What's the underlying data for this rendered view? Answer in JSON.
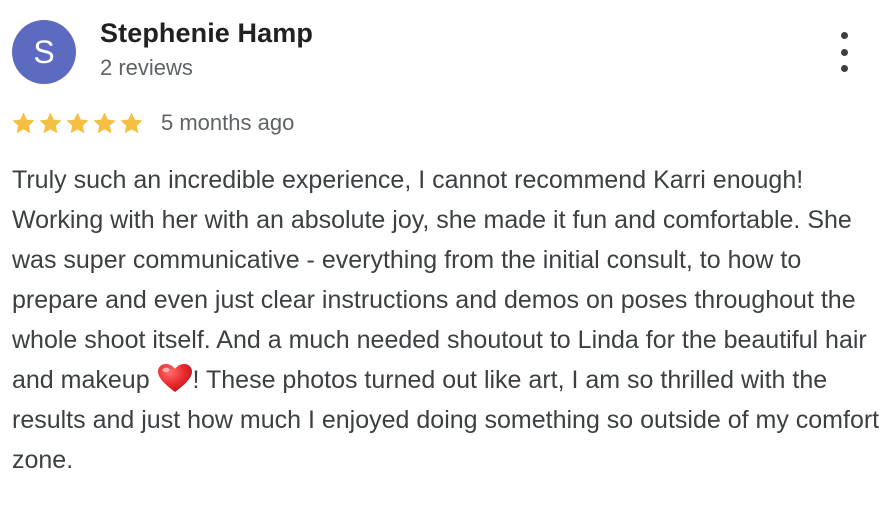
{
  "reviewer": {
    "avatar_letter": "S",
    "avatar_color": "#5c6bc0",
    "name": "Stephenie Hamp",
    "review_count": "2 reviews"
  },
  "menu": {
    "icon": "more-vert-icon"
  },
  "rating": {
    "stars": 5,
    "max_stars": 5,
    "star_color": "#f4bf42",
    "time_ago": "5 months ago"
  },
  "review": {
    "text_part1": "Truly such an incredible experience, I cannot recommend Karri enough! Working with her with an absolute joy, she made it fun and comfortable. She was super communicative - everything from the initial consult, to how to prepare and even just clear instructions and demos on poses throughout the whole shoot itself. And a much needed shoutout to Linda for the beautiful hair and makeup ",
    "emoji": "heart-emoji",
    "text_part2": "! These photos turned out like art, I am so thrilled with the results and just how much I enjoyed doing something so outside of my comfort zone."
  }
}
